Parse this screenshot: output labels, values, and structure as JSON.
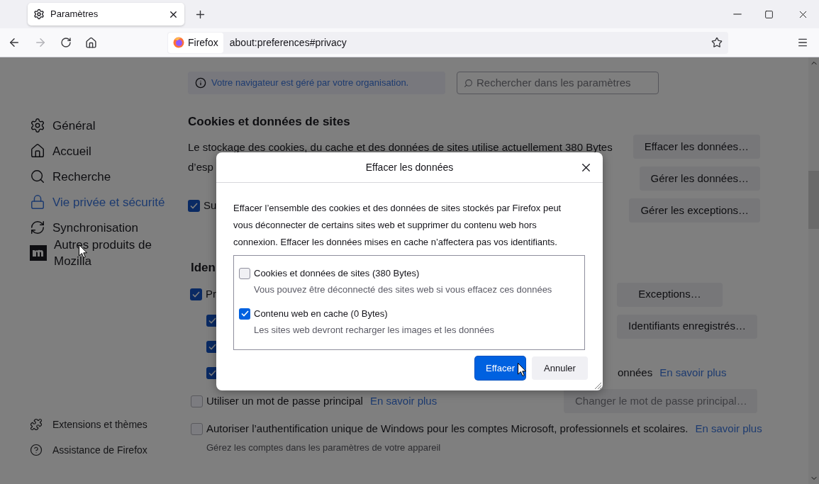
{
  "tabs": [
    {
      "label": "Paramètres",
      "selected": true
    }
  ],
  "address_bar": {
    "identity": "Firefox",
    "url": "about:preferences#privacy"
  },
  "sidebar": {
    "items": [
      {
        "label": "Général",
        "selected": false
      },
      {
        "label": "Accueil",
        "selected": false
      },
      {
        "label": "Recherche",
        "selected": false
      },
      {
        "label": "Vie privée et sécurité",
        "selected": true
      },
      {
        "label": "Synchronisation",
        "selected": false
      },
      {
        "label": "Autres produits de Mozilla",
        "selected": false
      }
    ],
    "footer": [
      "Extensions et thèmes",
      "Assistance de Firefox"
    ]
  },
  "banner": "Votre navigateur est géré par votre organisation.",
  "search": {
    "placeholder": "Rechercher dans les paramètres"
  },
  "cookies": {
    "heading": "Cookies et données de sites",
    "text_line_1": "Le stockage des cookies, du cache et des données de sites utilise actuellement 380 Bytes",
    "text_line_2": "d’esp",
    "buttons": [
      "Effacer les données…",
      "Gérer les données…",
      "Gérer les exceptions…"
    ],
    "checkbox": {
      "label": "Su",
      "checked": true
    }
  },
  "passwords": {
    "heading": "Iden",
    "checkbox": {
      "label": "Pr",
      "checked": true
    },
    "sub_checkboxes": [
      {
        "checked": true
      },
      {
        "checked": true
      },
      {
        "checked": true,
        "label": "onnées",
        "link": "En savoir plus"
      }
    ],
    "buttons": [
      "Exceptions…",
      "Identifiants enregistrés…"
    ]
  },
  "primary_password": {
    "label": "Utiliser un mot de passe principal",
    "checked": false,
    "link": "En savoir plus",
    "button": {
      "label": "Changer le mot de passe principal…",
      "disabled": true
    }
  },
  "windows_sso": {
    "label": "Autoriser l’authentification unique de Windows pour les comptes Microsoft, professionnels et scolaires.",
    "checked": false,
    "link": "En savoir plus",
    "hint": "Gérez les comptes dans les paramètres de votre appareil"
  },
  "dialog": {
    "title": "Effacer les données",
    "description": "Effacer l’ensemble des cookies et des données de sites stockés par Firefox peut vous déconnecter de certains sites web et supprimer du contenu web hors connexion. Effacer les données mises en cache n’affectera pas vos identifiants.",
    "options": [
      {
        "label": "Cookies et données de sites (380 Bytes)",
        "hint": "Vous pouvez être déconnecté des sites web si vous effacez ces données",
        "checked": false
      },
      {
        "label": "Contenu web en cache (0 Bytes)",
        "hint": "Les sites web devront recharger les images et les données",
        "checked": true
      }
    ],
    "buttons": [
      {
        "label": "Effacer",
        "primary": true
      },
      {
        "label": "Annuler",
        "primary": false
      }
    ]
  }
}
